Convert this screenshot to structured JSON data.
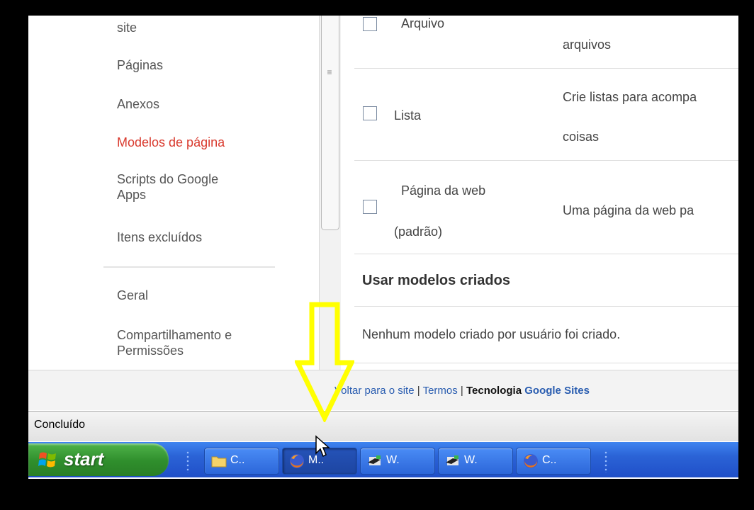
{
  "sidebar": {
    "items": [
      {
        "label": "site"
      },
      {
        "label": "Páginas"
      },
      {
        "label": "Anexos"
      },
      {
        "label": "Modelos de página",
        "active": true
      },
      {
        "label": "Scripts do Google"
      },
      {
        "label": "Apps"
      },
      {
        "label": "Itens excluídos"
      },
      {
        "label": "Geral"
      },
      {
        "label": "Compartilhamento e"
      },
      {
        "label": "Permissões"
      }
    ]
  },
  "templates": {
    "rows": [
      {
        "name": "Arquivo",
        "desc2": "arquivos"
      },
      {
        "name": "Lista",
        "desc1": "Crie listas para acompa",
        "desc2": "coisas"
      },
      {
        "name1": "Página da web",
        "name2": "(padrão)",
        "desc1": "Uma página da web pa"
      }
    ],
    "section_title": "Usar modelos criados",
    "empty_message": "Nenhum modelo criado por usuário foi criado."
  },
  "footer": {
    "back_link": "Voltar para o site",
    "sep1": "|",
    "terms_link": "Termos",
    "sep2": "|",
    "tech_label": "Tecnologia",
    "sites_link": "Google Sites"
  },
  "status": {
    "text": "Concluído"
  },
  "taskbar": {
    "start_label": "start",
    "tasks": [
      {
        "label": "C..",
        "icon": "folder-icon"
      },
      {
        "label": "M..",
        "icon": "firefox-icon",
        "active": true
      },
      {
        "label": "W.",
        "icon": "app-icon"
      },
      {
        "label": "W.",
        "icon": "app-icon"
      },
      {
        "label": "C..",
        "icon": "firefox-icon"
      }
    ]
  },
  "colors": {
    "active_nav": "#d93a2e",
    "link": "#2a5db0",
    "annotation_arrow": "#ffff00",
    "taskbar": "#2b63d6",
    "start_button": "#3a9a36"
  }
}
